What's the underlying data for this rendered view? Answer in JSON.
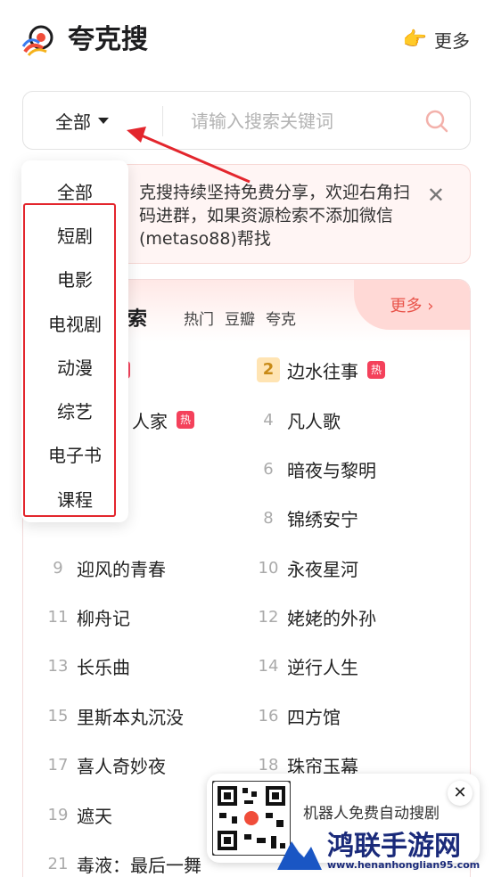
{
  "app": {
    "title": "夸克搜",
    "more_label": "更多"
  },
  "search": {
    "category": "全部",
    "placeholder": "请输入搜索关键词"
  },
  "notice": {
    "text": "克搜持续坚持免费分享，欢迎右角扫码进群，如果资源检索不添加微信(metaso88)帮找"
  },
  "hot": {
    "title": "搜索",
    "tabs": [
      "热门",
      "豆瓣",
      "夸克"
    ],
    "more": "更多 ›",
    "badge": "热",
    "items": [
      {
        "rank": "",
        "name": "",
        "hot": true
      },
      {
        "rank": "2",
        "name": "边水往事",
        "hot": true
      },
      {
        "rank": "",
        "name": "人家",
        "hot": true
      },
      {
        "rank": "4",
        "name": "凡人歌",
        "hot": false
      },
      {
        "rank": "",
        "name": "",
        "hot": false
      },
      {
        "rank": "6",
        "name": "暗夜与黎明",
        "hot": false
      },
      {
        "rank": "8",
        "name": "锦绣安宁",
        "hot": false
      },
      {
        "rank": "9",
        "name": "迎风的青春",
        "hot": false
      },
      {
        "rank": "10",
        "name": "永夜星河",
        "hot": false
      },
      {
        "rank": "11",
        "name": "柳舟记",
        "hot": false
      },
      {
        "rank": "12",
        "name": "姥姥的外孙",
        "hot": false
      },
      {
        "rank": "13",
        "name": "长乐曲",
        "hot": false
      },
      {
        "rank": "14",
        "name": "逆行人生",
        "hot": false
      },
      {
        "rank": "15",
        "name": "里斯本丸沉没",
        "hot": false
      },
      {
        "rank": "16",
        "name": "四方馆",
        "hot": false
      },
      {
        "rank": "17",
        "name": "喜人奇妙夜",
        "hot": false
      },
      {
        "rank": "18",
        "name": "珠帘玉幕",
        "hot": false
      },
      {
        "rank": "19",
        "name": "遮天",
        "hot": false
      },
      {
        "rank": "21",
        "name": "毒液：最后一舞",
        "hot": false
      }
    ]
  },
  "dropdown": {
    "options": [
      "全部",
      "短剧",
      "电影",
      "电视剧",
      "动漫",
      "综艺",
      "电子书",
      "课程"
    ]
  },
  "qr_popup": {
    "text": "机器人免费自动搜剧"
  },
  "watermark": {
    "title": "鸿联手游网",
    "url": "www.henanhonglian95.com"
  },
  "colors": {
    "accent": "#e9544a",
    "highlight": "#e3262d",
    "hot_badge": "#f4415b"
  }
}
